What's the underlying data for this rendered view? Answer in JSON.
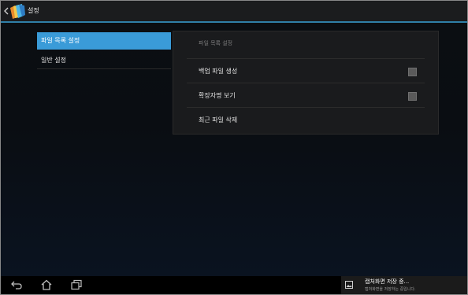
{
  "action_bar": {
    "title": "설정"
  },
  "left_menu": {
    "items": [
      {
        "label": "파일 목록 설정",
        "selected": true
      },
      {
        "label": "일반 설정",
        "selected": false
      }
    ]
  },
  "panel": {
    "header": "파일 목록 설정",
    "rows": [
      {
        "label": "백업 파일 생성",
        "checkbox": true,
        "checked": false
      },
      {
        "label": "확장자명 보기",
        "checkbox": true,
        "checked": false
      },
      {
        "label": "최근 파일 삭제",
        "checkbox": false
      }
    ]
  },
  "nav_bar": {
    "icons": [
      "back-icon",
      "home-icon",
      "recent-apps-icon"
    ]
  },
  "notification": {
    "title": "캡처화면 저장 중...",
    "subtitle": "캡처화면을 저장하는 중입니다."
  },
  "colors": {
    "accent": "#3a9bd8",
    "action_bar_divider": "#2f7fa8"
  }
}
